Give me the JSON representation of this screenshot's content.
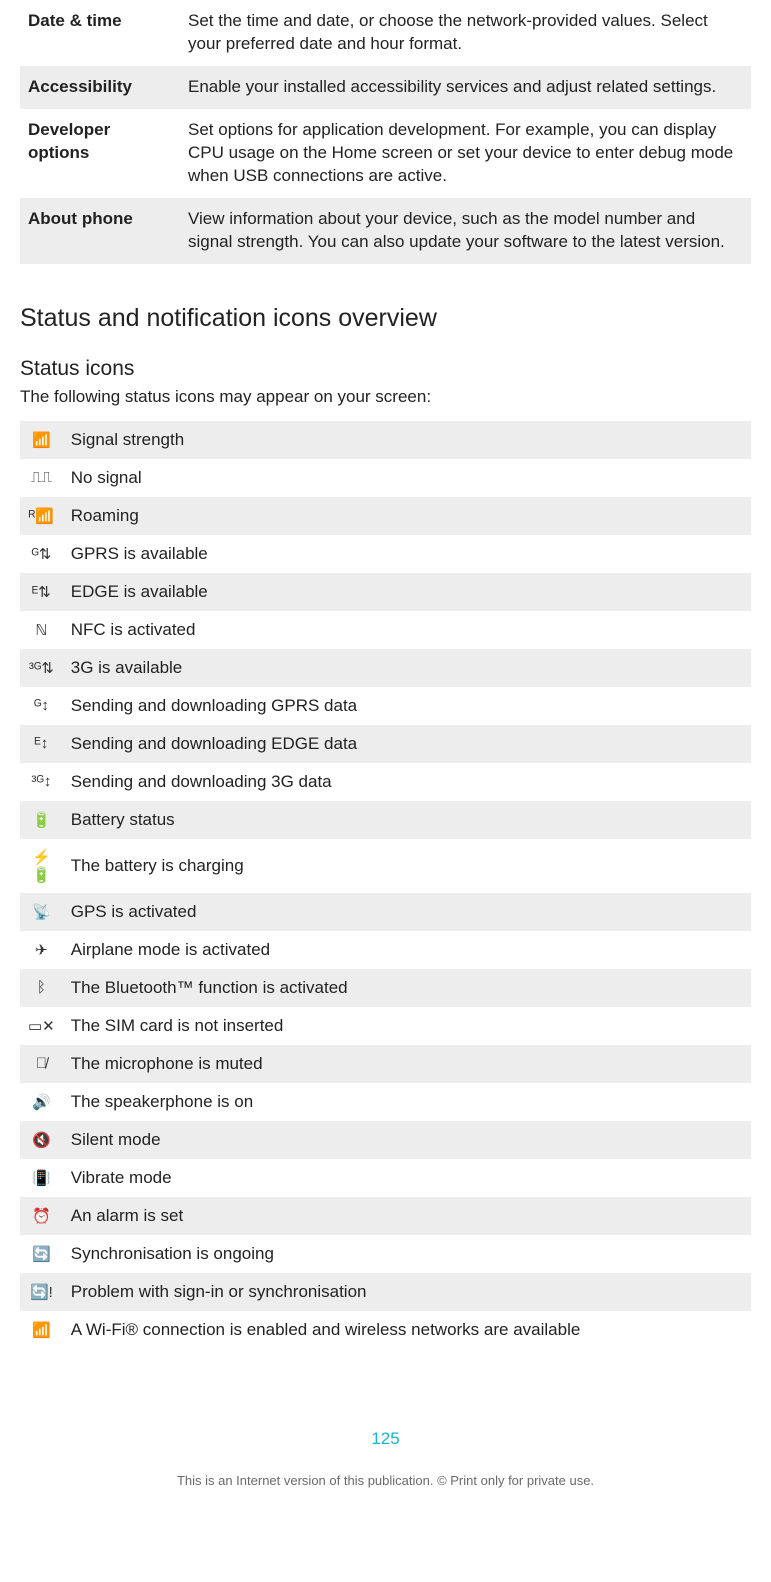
{
  "settings_rows": [
    {
      "label": "Date & time",
      "desc": "Set the time and date, or choose the network-provided values. Select your preferred date and hour format.",
      "shade": false
    },
    {
      "label": "Accessibility",
      "desc": "Enable your installed accessibility services and adjust related settings.",
      "shade": true
    },
    {
      "label": "Developer options",
      "desc": "Set options for application development. For example, you can display CPU usage on the Home screen or set your device to enter debug mode when USB connections are active.",
      "shade": false
    },
    {
      "label": "About phone",
      "desc": "View information about your device, such as the model number and signal strength. You can also update your software to the latest version.",
      "shade": true
    }
  ],
  "section_heading": "Status and notification icons overview",
  "subsection_heading": "Status icons",
  "lead_text": "The following status icons may appear on your screen:",
  "status_icons": [
    {
      "icon": "signal-strength-icon",
      "glyph": "📶",
      "desc": "Signal strength",
      "shade": true
    },
    {
      "icon": "no-signal-icon",
      "glyph": "⎍⎍",
      "desc": "No signal",
      "shade": false
    },
    {
      "icon": "roaming-icon",
      "glyph": "ᴿ📶",
      "desc": "Roaming",
      "shade": true
    },
    {
      "icon": "gprs-available-icon",
      "glyph": "ᴳ⇅",
      "desc": "GPRS is available",
      "shade": false
    },
    {
      "icon": "edge-available-icon",
      "glyph": "ᴱ⇅",
      "desc": "EDGE is available",
      "shade": true
    },
    {
      "icon": "nfc-activated-icon",
      "glyph": "ℕ",
      "desc": "NFC is activated",
      "shade": false
    },
    {
      "icon": "3g-available-icon",
      "glyph": "³ᴳ⇅",
      "desc": "3G is available",
      "shade": true
    },
    {
      "icon": "gprs-data-icon",
      "glyph": "ᴳ↕",
      "desc": "Sending and downloading GPRS data",
      "shade": false
    },
    {
      "icon": "edge-data-icon",
      "glyph": "ᴱ↕",
      "desc": "Sending and downloading EDGE data",
      "shade": true
    },
    {
      "icon": "3g-data-icon",
      "glyph": "³ᴳ↕",
      "desc": "Sending and downloading 3G data",
      "shade": false
    },
    {
      "icon": "battery-status-icon",
      "glyph": "🔋",
      "desc": "Battery status",
      "shade": true
    },
    {
      "icon": "battery-charging-icon",
      "glyph": "⚡🔋",
      "desc": "The battery is charging",
      "shade": false
    },
    {
      "icon": "gps-activated-icon",
      "glyph": "📡",
      "desc": "GPS is activated",
      "shade": true
    },
    {
      "icon": "airplane-mode-icon",
      "glyph": "✈",
      "desc": "Airplane mode is activated",
      "shade": false
    },
    {
      "icon": "bluetooth-icon",
      "glyph": "ᛒ",
      "desc": "The Bluetooth™ function is activated",
      "shade": true
    },
    {
      "icon": "no-sim-icon",
      "glyph": "▭✕",
      "desc": "The SIM card is not inserted",
      "shade": false
    },
    {
      "icon": "mic-muted-icon",
      "glyph": "🎙̸",
      "desc": "The microphone is muted",
      "shade": true
    },
    {
      "icon": "speakerphone-icon",
      "glyph": "🔊",
      "desc": "The speakerphone is on",
      "shade": false
    },
    {
      "icon": "silent-mode-icon",
      "glyph": "🔇",
      "desc": "Silent mode",
      "shade": true
    },
    {
      "icon": "vibrate-mode-icon",
      "glyph": "📳",
      "desc": "Vibrate mode",
      "shade": false
    },
    {
      "icon": "alarm-set-icon",
      "glyph": "⏰",
      "desc": "An alarm is set",
      "shade": true
    },
    {
      "icon": "sync-ongoing-icon",
      "glyph": "🔄",
      "desc": "Synchronisation is ongoing",
      "shade": false
    },
    {
      "icon": "sync-problem-icon",
      "glyph": "🔄!",
      "desc": "Problem with sign-in or synchronisation",
      "shade": true
    },
    {
      "icon": "wifi-icon",
      "glyph": "📶",
      "desc": "A Wi-Fi® connection is enabled and wireless networks are available",
      "shade": false
    }
  ],
  "page_number": "125",
  "copyright_text": "This is an Internet version of this publication. © Print only for private use."
}
